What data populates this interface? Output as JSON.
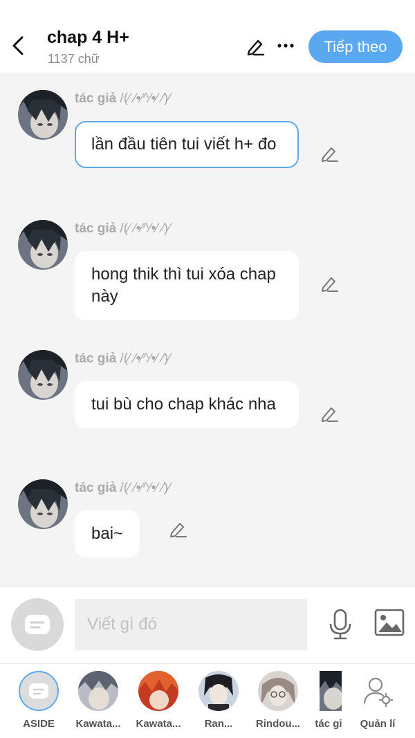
{
  "header": {
    "title": "chap 4 H+",
    "word_count": "1137 chữ",
    "next_label": "Tiếp theo"
  },
  "messages": [
    {
      "author": "tác giả",
      "emoticon": "/(⁄ ⁄•⁄^⁄•⁄ ⁄)⁄",
      "text": "lần đầu tiên tui viết h+ đo",
      "selected": true
    },
    {
      "author": "tác giả",
      "emoticon": "/(⁄ ⁄•⁄^⁄•⁄ ⁄)⁄",
      "text": "hong thik thì tui xóa chap này"
    },
    {
      "author": "tác giả",
      "emoticon": "/(⁄ ⁄•⁄^⁄•⁄ ⁄)⁄",
      "text": "tui bù cho chap khác nha"
    },
    {
      "author": "tác giả",
      "emoticon": "/(⁄ ⁄•⁄^⁄•⁄ ⁄)⁄",
      "text": "bai~"
    }
  ],
  "input": {
    "placeholder": "Viết gì đó"
  },
  "characters": [
    {
      "label": "ASIDE"
    },
    {
      "label": "Kawata..."
    },
    {
      "label": "Kawata..."
    },
    {
      "label": "Ran..."
    },
    {
      "label": "Rindou..."
    },
    {
      "label": "tác gi"
    },
    {
      "label": "Quản lí"
    }
  ],
  "colors": {
    "accent": "#5aa9f0",
    "background": "#f4f4f4",
    "bubble": "#ffffff",
    "author_text": "#a8a8a8"
  },
  "icons": [
    "back-arrow-icon",
    "pencil-icon",
    "more-icon",
    "message-icon",
    "microphone-icon",
    "image-icon",
    "user-settings-icon"
  ]
}
